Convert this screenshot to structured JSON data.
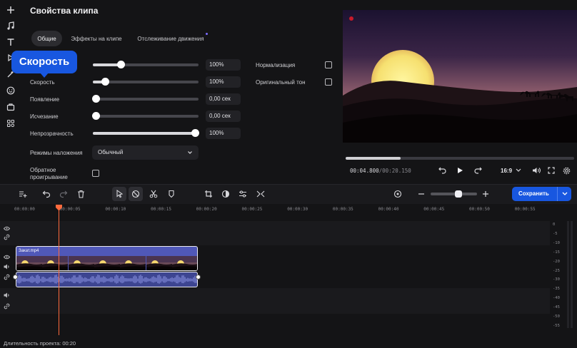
{
  "panel": {
    "title": "Свойства клипа",
    "tabs": [
      "Общие",
      "Эффекты на клипе",
      "Отслеживание движения"
    ],
    "tooltip": "Скорость"
  },
  "properties": {
    "volume_value": "100%",
    "speed_label": "Скорость",
    "speed_value": "100%",
    "fade_in_label": "Появление",
    "fade_in_value": "0,00 сек",
    "fade_out_label": "Исчезание",
    "fade_out_value": "0,00 сек",
    "opacity_label": "Непрозрачность",
    "opacity_value": "100%",
    "blend_label": "Режимы наложения",
    "blend_value": "Обычный",
    "reverse_label_1": "Обратное",
    "reverse_label_2": "проигрывание",
    "normalize_label": "Нормализация",
    "original_tone_label": "Оригинальный тон",
    "levels": {
      "volume": 0.27,
      "speed": 0.12,
      "fade_in": 0.0,
      "fade_out": 0.0,
      "opacity": 1.0
    }
  },
  "preview": {
    "time_current": "00:04.800",
    "time_total": "/00:20.150",
    "aspect": "16:9",
    "progress": 0.24
  },
  "timeline": {
    "save_label": "Сохранить",
    "ruler": [
      "00:00:00",
      "00:00:05",
      "00:00:10",
      "00:00:15",
      "00:00:20",
      "00:00:25",
      "00:00:30",
      "00:00:35",
      "00:00:40",
      "00:00:45",
      "00:00:50",
      "00:00:55"
    ],
    "clip_name": "Закат.mp4",
    "meter_labels": [
      "0",
      "-5",
      "-10",
      "-15",
      "-20",
      "-25",
      "-30",
      "-35",
      "-40",
      "-45",
      "-50",
      "-55"
    ],
    "duration": "Длительность проекта: 00:20",
    "zoom_level": 0.6
  },
  "colors": {
    "accent": "#1857e0",
    "playhead": "#ff6a3d",
    "clip": "#5058b8"
  },
  "icons": [
    "plus-icon",
    "music-icon",
    "text-icon",
    "transition-icon",
    "effects-icon",
    "sticker-icon",
    "media-icon",
    "apps-icon"
  ]
}
